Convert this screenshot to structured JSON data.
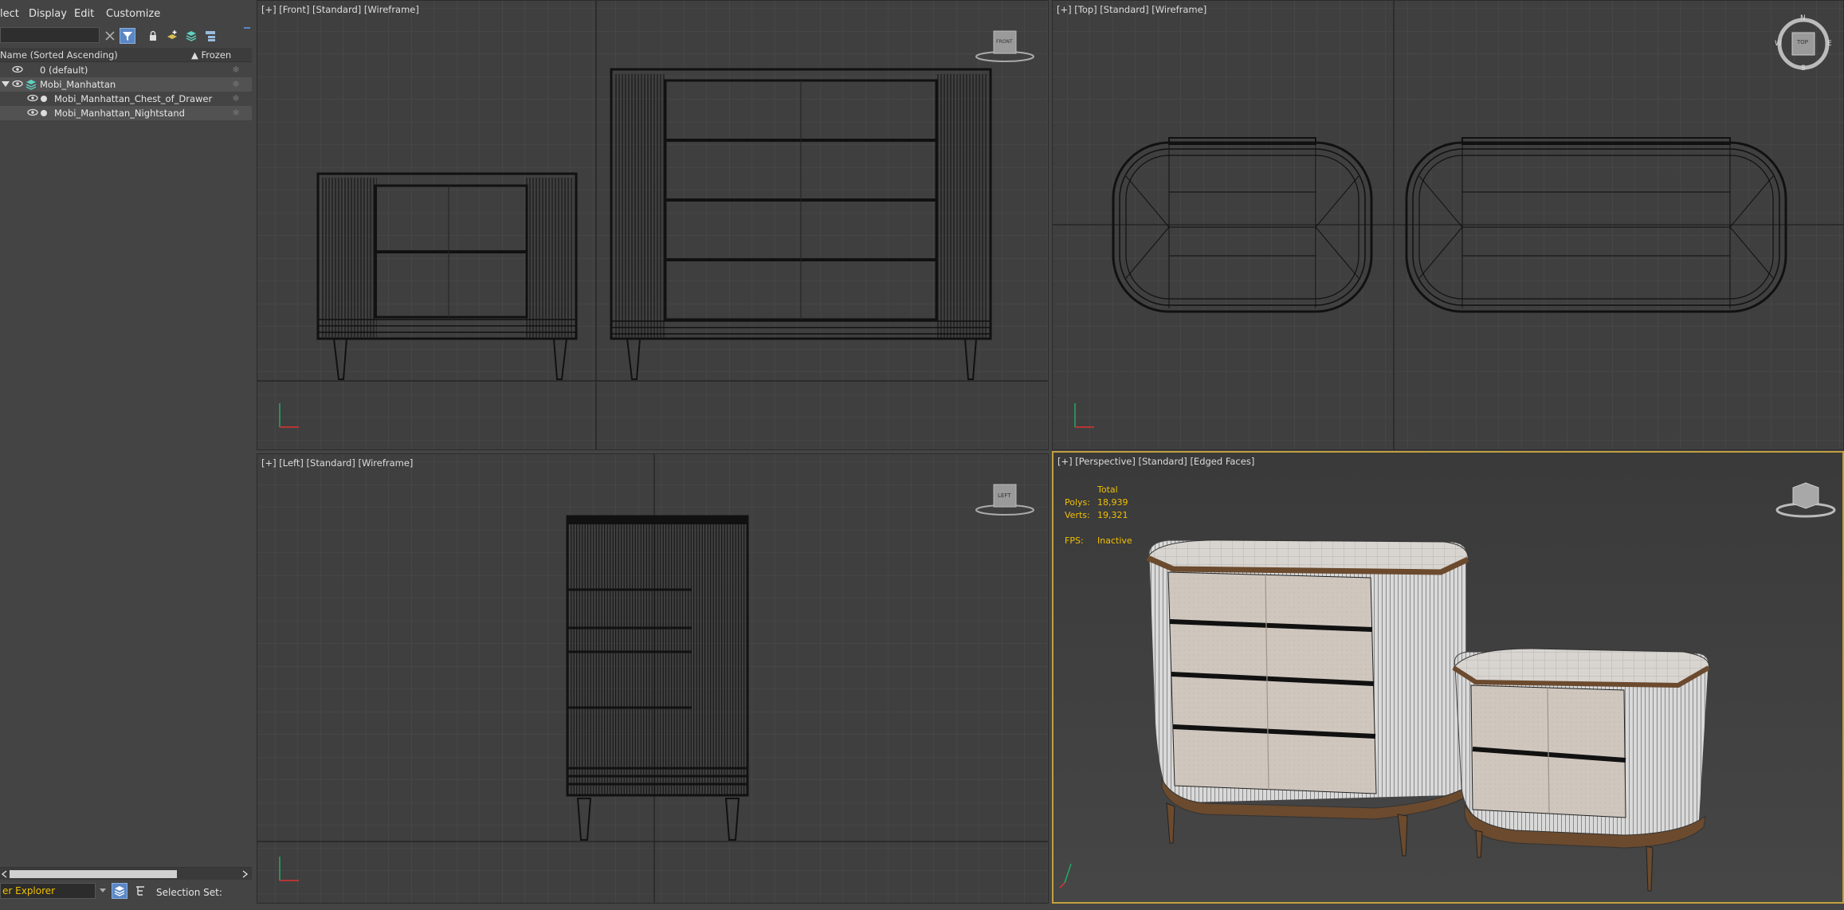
{
  "menu": {
    "select": "lect",
    "display": "Display",
    "edit": "Edit",
    "customize": "Customize"
  },
  "columns": {
    "name": "Name (Sorted Ascending)",
    "frozen": "▲ Frozen"
  },
  "tree": {
    "items": [
      {
        "label": "0 (default)"
      },
      {
        "label": "Mobi_Manhattan"
      },
      {
        "label": "Mobi_Manhattan_Chest_of_Drawer"
      },
      {
        "label": "Mobi_Manhattan_Nightstand"
      }
    ]
  },
  "bottombar": {
    "explorer_mode": "er Explorer",
    "selection_set": "Selection Set:"
  },
  "viewports": {
    "front": "[+] [Front] [Standard] [Wireframe]",
    "top": "[+] [Top] [Standard] [Wireframe]",
    "left": "[+] [Left] [Standard] [Wireframe]",
    "perspective": "[+] [Perspective] [Standard] [Edged Faces]"
  },
  "viewcube": {
    "front": "FRONT",
    "top": "TOP",
    "left": "LEFT",
    "compass_n": "N",
    "compass_s": "S",
    "compass_e": "E",
    "compass_w": "W"
  },
  "stats": {
    "total": "Total",
    "polys_label": "Polys:",
    "polys_value": "18,939",
    "verts_label": "Verts:",
    "verts_value": "19,321",
    "fps_label": "FPS:",
    "fps_value": "Inactive"
  },
  "colors": {
    "viewport_bg": "#3f3f3f",
    "active_border": "#c0a040",
    "stats_yellow": "#f0c000",
    "wood": "#6b4a2e",
    "fabric": "#cfc6bd"
  }
}
